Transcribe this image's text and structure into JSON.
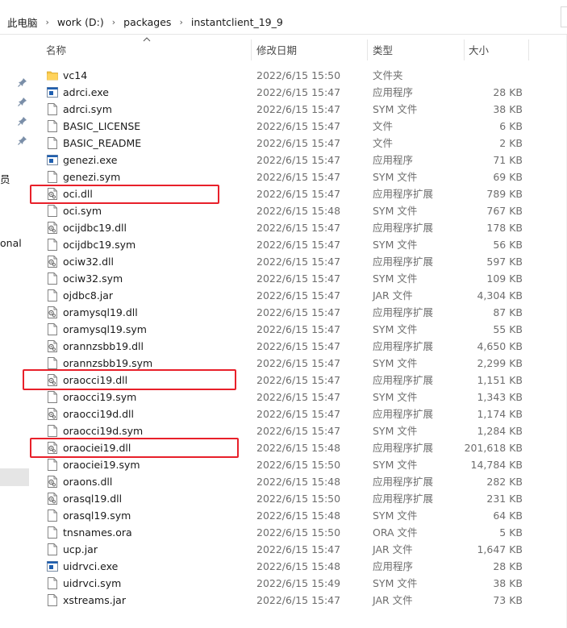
{
  "breadcrumb": [
    "此电脑",
    "work (D:)",
    "packages",
    "instantclient_19_9"
  ],
  "nav": {
    "partial_items": [
      "员",
      "onal"
    ]
  },
  "columns": {
    "name": "名称",
    "date": "修改日期",
    "type": "类型",
    "size": "大小",
    "sorted_by": "name"
  },
  "files": [
    {
      "name": "vc14",
      "date": "2022/6/15 15:50",
      "type": "文件夹",
      "size": "",
      "icon": "folder-icon"
    },
    {
      "name": "adrci.exe",
      "date": "2022/6/15 15:47",
      "type": "应用程序",
      "size": "28 KB",
      "icon": "exe-icon"
    },
    {
      "name": "adrci.sym",
      "date": "2022/6/15 15:47",
      "type": "SYM 文件",
      "size": "38 KB",
      "icon": "file-icon"
    },
    {
      "name": "BASIC_LICENSE",
      "date": "2022/6/15 15:47",
      "type": "文件",
      "size": "6 KB",
      "icon": "file-icon"
    },
    {
      "name": "BASIC_README",
      "date": "2022/6/15 15:47",
      "type": "文件",
      "size": "2 KB",
      "icon": "file-icon"
    },
    {
      "name": "genezi.exe",
      "date": "2022/6/15 15:47",
      "type": "应用程序",
      "size": "71 KB",
      "icon": "exe-icon"
    },
    {
      "name": "genezi.sym",
      "date": "2022/6/15 15:47",
      "type": "SYM 文件",
      "size": "69 KB",
      "icon": "file-icon"
    },
    {
      "name": "oci.dll",
      "date": "2022/6/15 15:47",
      "type": "应用程序扩展",
      "size": "789 KB",
      "icon": "dll-icon",
      "highlighted": true
    },
    {
      "name": "oci.sym",
      "date": "2022/6/15 15:48",
      "type": "SYM 文件",
      "size": "767 KB",
      "icon": "file-icon"
    },
    {
      "name": "ocijdbc19.dll",
      "date": "2022/6/15 15:47",
      "type": "应用程序扩展",
      "size": "178 KB",
      "icon": "dll-icon"
    },
    {
      "name": "ocijdbc19.sym",
      "date": "2022/6/15 15:47",
      "type": "SYM 文件",
      "size": "56 KB",
      "icon": "file-icon"
    },
    {
      "name": "ociw32.dll",
      "date": "2022/6/15 15:47",
      "type": "应用程序扩展",
      "size": "597 KB",
      "icon": "dll-icon"
    },
    {
      "name": "ociw32.sym",
      "date": "2022/6/15 15:47",
      "type": "SYM 文件",
      "size": "109 KB",
      "icon": "file-icon"
    },
    {
      "name": "ojdbc8.jar",
      "date": "2022/6/15 15:47",
      "type": "JAR 文件",
      "size": "4,304 KB",
      "icon": "file-icon"
    },
    {
      "name": "oramysql19.dll",
      "date": "2022/6/15 15:47",
      "type": "应用程序扩展",
      "size": "87 KB",
      "icon": "dll-icon"
    },
    {
      "name": "oramysql19.sym",
      "date": "2022/6/15 15:47",
      "type": "SYM 文件",
      "size": "55 KB",
      "icon": "file-icon"
    },
    {
      "name": "orannzsbb19.dll",
      "date": "2022/6/15 15:47",
      "type": "应用程序扩展",
      "size": "4,650 KB",
      "icon": "dll-icon"
    },
    {
      "name": "orannzsbb19.sym",
      "date": "2022/6/15 15:47",
      "type": "SYM 文件",
      "size": "2,299 KB",
      "icon": "file-icon"
    },
    {
      "name": "oraocci19.dll",
      "date": "2022/6/15 15:47",
      "type": "应用程序扩展",
      "size": "1,151 KB",
      "icon": "dll-icon",
      "highlighted": true
    },
    {
      "name": "oraocci19.sym",
      "date": "2022/6/15 15:47",
      "type": "SYM 文件",
      "size": "1,343 KB",
      "icon": "file-icon"
    },
    {
      "name": "oraocci19d.dll",
      "date": "2022/6/15 15:47",
      "type": "应用程序扩展",
      "size": "1,174 KB",
      "icon": "dll-icon"
    },
    {
      "name": "oraocci19d.sym",
      "date": "2022/6/15 15:47",
      "type": "SYM 文件",
      "size": "1,284 KB",
      "icon": "file-icon"
    },
    {
      "name": "oraociei19.dll",
      "date": "2022/6/15 15:48",
      "type": "应用程序扩展",
      "size": "201,618 KB",
      "icon": "dll-icon",
      "highlighted": true
    },
    {
      "name": "oraociei19.sym",
      "date": "2022/6/15 15:50",
      "type": "SYM 文件",
      "size": "14,784 KB",
      "icon": "file-icon"
    },
    {
      "name": "oraons.dll",
      "date": "2022/6/15 15:48",
      "type": "应用程序扩展",
      "size": "282 KB",
      "icon": "dll-icon"
    },
    {
      "name": "orasql19.dll",
      "date": "2022/6/15 15:50",
      "type": "应用程序扩展",
      "size": "231 KB",
      "icon": "dll-icon"
    },
    {
      "name": "orasql19.sym",
      "date": "2022/6/15 15:48",
      "type": "SYM 文件",
      "size": "64 KB",
      "icon": "file-icon"
    },
    {
      "name": "tnsnames.ora",
      "date": "2022/6/15 15:50",
      "type": "ORA 文件",
      "size": "5 KB",
      "icon": "file-icon"
    },
    {
      "name": "ucp.jar",
      "date": "2022/6/15 15:47",
      "type": "JAR 文件",
      "size": "1,647 KB",
      "icon": "file-icon"
    },
    {
      "name": "uidrvci.exe",
      "date": "2022/6/15 15:48",
      "type": "应用程序",
      "size": "28 KB",
      "icon": "exe-icon"
    },
    {
      "name": "uidrvci.sym",
      "date": "2022/6/15 15:49",
      "type": "SYM 文件",
      "size": "38 KB",
      "icon": "file-icon"
    },
    {
      "name": "xstreams.jar",
      "date": "2022/6/15 15:47",
      "type": "JAR 文件",
      "size": "73 KB",
      "icon": "file-icon"
    }
  ],
  "colors": {
    "highlight_box": "#e8202a",
    "folder": "#f5c342",
    "exe_accent": "#1f5fb0",
    "text_secondary": "#6d6d6d"
  }
}
